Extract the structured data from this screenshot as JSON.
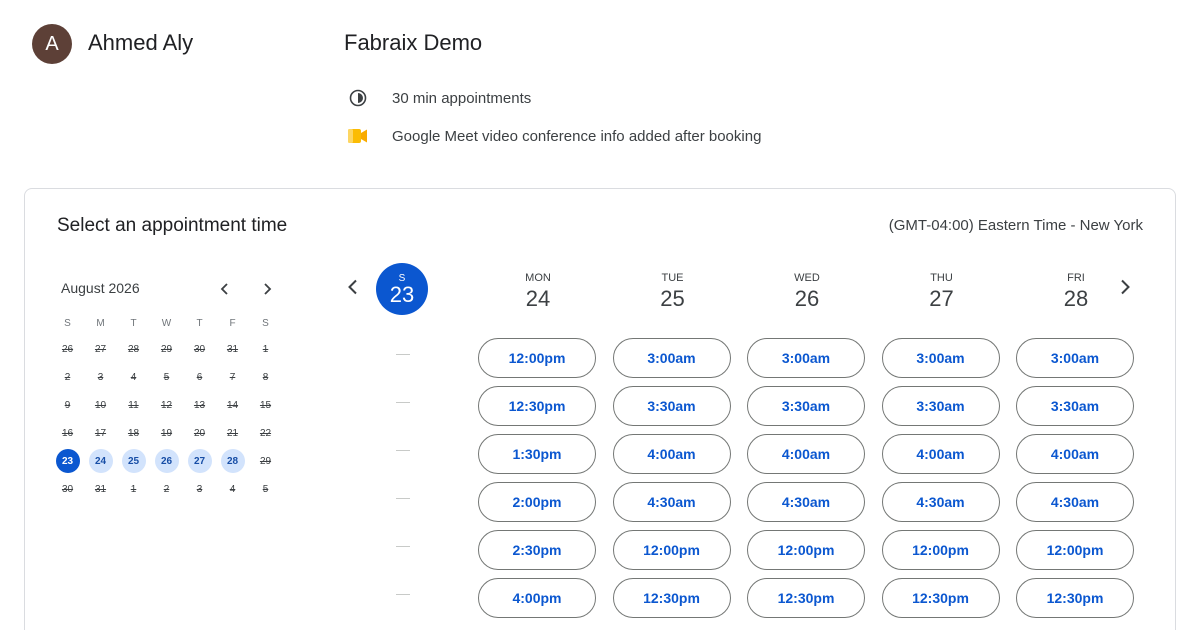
{
  "host": {
    "initial": "A",
    "name": "Ahmed Aly",
    "avatar_color": "#5d4037"
  },
  "event": {
    "title": "Fabraix Demo",
    "duration_text": "30 min appointments",
    "duration_icon": "clock-icon",
    "meet_text": "Google Meet video conference info added after booking",
    "meet_icon": "google-meet-icon"
  },
  "scheduler": {
    "title": "Select an appointment time",
    "timezone": "(GMT-04:00) Eastern Time - New York"
  },
  "mini_calendar": {
    "month_label": "August 2026",
    "weekday_labels": [
      "S",
      "M",
      "T",
      "W",
      "T",
      "F",
      "S"
    ],
    "weeks": [
      [
        {
          "d": "26",
          "s": "past"
        },
        {
          "d": "27",
          "s": "past"
        },
        {
          "d": "28",
          "s": "past"
        },
        {
          "d": "29",
          "s": "past"
        },
        {
          "d": "30",
          "s": "past"
        },
        {
          "d": "31",
          "s": "past"
        },
        {
          "d": "1",
          "s": "past"
        }
      ],
      [
        {
          "d": "2",
          "s": "past"
        },
        {
          "d": "3",
          "s": "past"
        },
        {
          "d": "4",
          "s": "past"
        },
        {
          "d": "5",
          "s": "past"
        },
        {
          "d": "6",
          "s": "past"
        },
        {
          "d": "7",
          "s": "past"
        },
        {
          "d": "8",
          "s": "past"
        }
      ],
      [
        {
          "d": "9",
          "s": "past"
        },
        {
          "d": "10",
          "s": "past"
        },
        {
          "d": "11",
          "s": "past"
        },
        {
          "d": "12",
          "s": "past"
        },
        {
          "d": "13",
          "s": "past"
        },
        {
          "d": "14",
          "s": "past"
        },
        {
          "d": "15",
          "s": "past"
        }
      ],
      [
        {
          "d": "16",
          "s": "past"
        },
        {
          "d": "17",
          "s": "past"
        },
        {
          "d": "18",
          "s": "past"
        },
        {
          "d": "19",
          "s": "past"
        },
        {
          "d": "20",
          "s": "past"
        },
        {
          "d": "21",
          "s": "past"
        },
        {
          "d": "22",
          "s": "past"
        }
      ],
      [
        {
          "d": "23",
          "s": "selected"
        },
        {
          "d": "24",
          "s": "avail"
        },
        {
          "d": "25",
          "s": "avail"
        },
        {
          "d": "26",
          "s": "avail"
        },
        {
          "d": "27",
          "s": "avail"
        },
        {
          "d": "28",
          "s": "avail"
        },
        {
          "d": "29",
          "s": "past"
        }
      ],
      [
        {
          "d": "30",
          "s": "past"
        },
        {
          "d": "31",
          "s": "past"
        },
        {
          "d": "1",
          "s": "past"
        },
        {
          "d": "2",
          "s": "past"
        },
        {
          "d": "3",
          "s": "past"
        },
        {
          "d": "4",
          "s": "past"
        },
        {
          "d": "5",
          "s": "past"
        }
      ]
    ]
  },
  "week": {
    "today": {
      "dow": "S",
      "day": "23"
    },
    "no_slot_marker": "—",
    "no_slot_count": 6,
    "days": [
      {
        "dow": "MON",
        "day": "24",
        "slots": [
          "12:00pm",
          "12:30pm",
          "1:30pm",
          "2:00pm",
          "2:30pm",
          "4:00pm"
        ]
      },
      {
        "dow": "TUE",
        "day": "25",
        "slots": [
          "3:00am",
          "3:30am",
          "4:00am",
          "4:30am",
          "12:00pm",
          "12:30pm"
        ]
      },
      {
        "dow": "WED",
        "day": "26",
        "slots": [
          "3:00am",
          "3:30am",
          "4:00am",
          "4:30am",
          "12:00pm",
          "12:30pm"
        ]
      },
      {
        "dow": "THU",
        "day": "27",
        "slots": [
          "3:00am",
          "3:30am",
          "4:00am",
          "4:30am",
          "12:00pm",
          "12:30pm"
        ]
      },
      {
        "dow": "FRI",
        "day": "28",
        "slots": [
          "3:00am",
          "3:30am",
          "4:00am",
          "4:30am",
          "12:00pm",
          "12:30pm"
        ]
      }
    ]
  },
  "colors": {
    "accent": "#0b57d0",
    "available_day": "#d2e3fc",
    "border": "#dadce0"
  }
}
